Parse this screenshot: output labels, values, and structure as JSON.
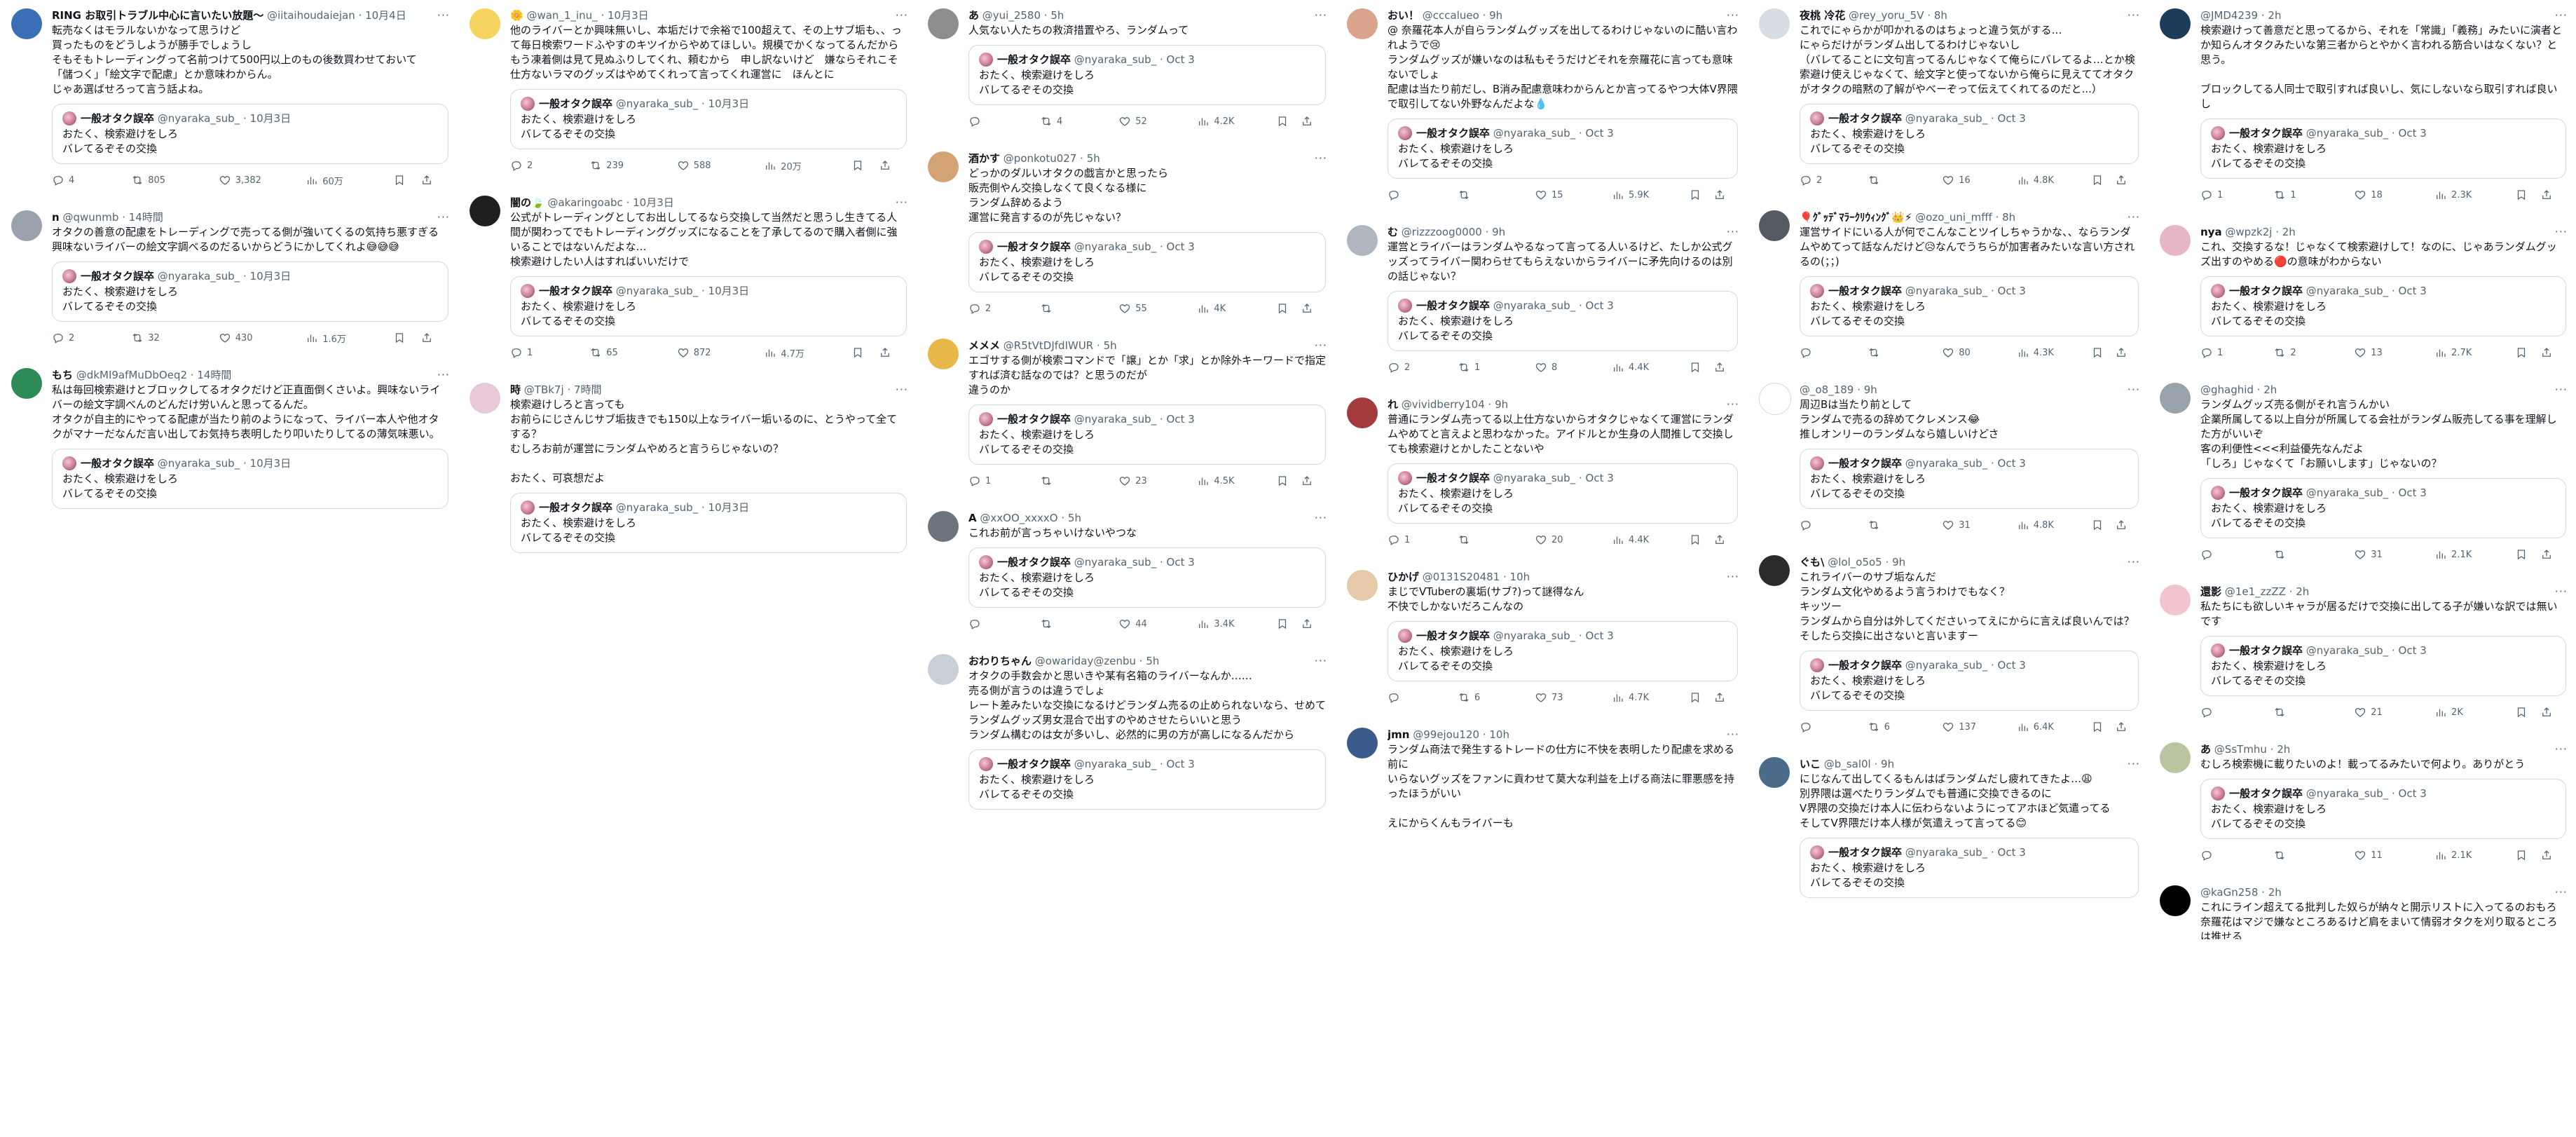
{
  "quote_default": {
    "name": "一般オタク誤卒",
    "handle": "@nyaraka_sub_",
    "text": "おたく、検索避けをしろ\nバレてるぞその交換"
  },
  "columns": [
    {
      "posts": [
        {
          "name": "RING お取引トラブル中心に言いたい放題〜",
          "handle": "@iitaihoudaiejan",
          "time": "10月4日",
          "avatar_color": "#3b6fb5",
          "text": "転売なくはモラルないかなって思うけど\n買ったものをどうしようが勝手でしょうし\nそもそもトレーディングって名前つけて500円以上のもの後数買わせておいて\n「儲つく」「絵文字で配慮」とか意味わからん。\nじゃあ選ばせろって言う話よね。",
          "quote_time": "10月3日",
          "reply": "4",
          "rt": "805",
          "like": "3,382",
          "view": "60万"
        },
        {
          "name": "n",
          "handle": "@qwunmb",
          "time": "14時間",
          "avatar_color": "#9aa3ad",
          "text": "オタクの善意の配慮をトレーディングで売ってる側が強いてくるの気持ち悪すぎる\n興味ないライバーの絵文字調べるのだるいからどうにかしてくれよ😅😅😅",
          "quote_time": "10月3日",
          "reply": "2",
          "rt": "32",
          "like": "430",
          "view": "1.6万"
        },
        {
          "name": "もち",
          "handle": "@dkMI9afMuDbOeq2",
          "time": "14時間",
          "avatar_color": "#2e8b57",
          "text": "私は毎回検索避けとブロックしてるオタクだけど正直面倒くさいよ。興味ないライバーの絵文字調べんのどんだけ労いんと思ってるんだ。\nオタクが自主的にやってる配慮が当たり前のようになって、ライバー本人や他オタクがマナーだなんだ言い出してお気持ち表明したり叩いたりしてるの薄気味悪い。",
          "quote_time": "10月3日",
          "reply": "",
          "rt": "",
          "like": "",
          "view": ""
        }
      ]
    },
    {
      "posts": [
        {
          "name": "🌼",
          "handle": "@wan_1_inu_",
          "time": "10月3日",
          "avatar_color": "#f4d35e",
          "text": "他のライバーとか興味無いし、本垢だけで余裕で100超えて、その上サブ垢も、、って毎日検索ワードふやすのキツイからやめてほしい。規模でかくなってるんだからもう凍着側は見て見ぬふりしてくれ、頼むから　申し訳ないけど　嫌ならそれこそ仕方ないラマのグッズはやめてくれって言ってくれ運営に　ほんとに",
          "quote_time": "10月3日",
          "reply": "2",
          "rt": "239",
          "like": "588",
          "view": "20万"
        },
        {
          "name": "闇の🍃",
          "handle": "@akaringoabc",
          "time": "10月3日",
          "avatar_color": "#1f1f1f",
          "text": "公式がトレーディングとしてお出ししてるなら交換して当然だと思うし生きてる人間が関わってでもトレーディンググッズになることを了承してるので購入者側に強いることではないんだよな…\n検索避けしたい人はすればいいだけで",
          "quote_time": "10月3日",
          "reply": "1",
          "rt": "65",
          "like": "872",
          "view": "4.7万"
        },
        {
          "name": "時",
          "handle": "@TBk7j",
          "time": "7時間",
          "avatar_color": "#e9c8d8",
          "text": "検索避けしろと言っても\nお前らにじさんじサブ垢抜きでも150以上なライバー垢いるのに、とうやって全てする？\nむしろお前が運営にランダムやめろと言うらじゃないの？\n\nおたく、可哀想だよ",
          "quote_time": "10月3日",
          "reply": "",
          "rt": "",
          "like": "",
          "view": ""
        }
      ]
    },
    {
      "posts": [
        {
          "name": "あ",
          "handle": "@yui_2580",
          "time": "5h",
          "avatar_color": "#8e8e8e",
          "text": "人気ない人たちの救済措置やろ、ランダムって",
          "quote_time": "Oct 3",
          "reply": "",
          "rt": "4",
          "like": "52",
          "view": "4.2K"
        },
        {
          "name": "酒かす",
          "handle": "@ponkotu027",
          "time": "5h",
          "avatar_color": "#d4a373",
          "text": "どっかのダルいオタクの戯言かと思ったら\n販売側やん交換しなくて良くなる様に\nランダム辞めるよう\n運営に発言するのが先じゃない？",
          "quote_time": "Oct 3",
          "reply": "2",
          "rt": "",
          "like": "55",
          "view": "4K"
        },
        {
          "name": "メメメ",
          "handle": "@R5tVtDJfdIWUR",
          "time": "5h",
          "avatar_color": "#e8b84a",
          "text": "エゴサする側が検索コマンドで「譲」とか「求」とか除外キーワードで指定すれば済む話なのでは？と思うのだが\n違うのか",
          "quote_time": "Oct 3",
          "reply": "1",
          "rt": "",
          "like": "23",
          "view": "4.5K"
        },
        {
          "name": "A",
          "handle": "@xxOO_xxxxO",
          "time": "5h",
          "avatar_color": "#6c757d",
          "text": "これお前が言っちゃいけないやつな",
          "quote_time": "Oct 3",
          "reply": "",
          "rt": "",
          "like": "44",
          "view": "3.4K"
        },
        {
          "name": "おわりちゃん",
          "handle": "@owariday@zenbu",
          "time": "5h",
          "avatar_color": "#c9cfd6",
          "text": "オタクの手数会かと思いきや某有名箱のライバーなんか……\n売る側が言うのは違うでしょ\nレート差みたいな交換になるけどランダム売るの止められないなら、せめてランダムグッズ男女混合で出すのやめさせたらいいと思う\nランダム構むのは女が多いし、必然的に男の方が高しになるんだから",
          "quote_time": "Oct 3",
          "reply": "",
          "rt": "",
          "like": "",
          "view": ""
        }
      ]
    },
    {
      "posts": [
        {
          "name": "おい！",
          "handle": "@cccalueo",
          "time": "9h",
          "avatar_color": "#d9a38c",
          "text": "@ 奈羅花本人が自らランダムグッズを出してるわけじゃないのに酷い言われようで😢\nランダムグッズが嫌いなのは私もそうだけどそれを奈羅花に言っても意味ないでしょ\n配慮は当たり前だし、B消み配慮意味わからんとか言ってるやつ大体V界隈で取引してない外野なんだよな💧",
          "quote_time": "Oct 3",
          "reply": "",
          "rt": "",
          "like": "15",
          "view": "5.9K"
        },
        {
          "name": "む",
          "handle": "@rizzzoog0000",
          "time": "9h",
          "avatar_color": "#b0b7bf",
          "text": "運営とライバーはランダムやるなって言ってる人いるけど、たしか公式グッズってライバー関わらせてもらえないからライバーに矛先向けるのは別の話じゃない？",
          "quote_time": "Oct 3",
          "reply": "2",
          "rt": "1",
          "like": "8",
          "view": "4.4K"
        },
        {
          "name": "れ",
          "handle": "@vividberry104",
          "time": "9h",
          "avatar_color": "#a23b3b",
          "text": "普通にランダム売ってる以上仕方ないからオタクじゃなくて運営にランダムやめてと言えよと思わなかった。アイドルとか生身の人間推して交換しても検索避けとかしたことないや",
          "quote_time": "Oct 3",
          "reply": "1",
          "rt": "",
          "like": "20",
          "view": "4.4K"
        },
        {
          "name": "ひかげ",
          "handle": "@0131S20481",
          "time": "10h",
          "avatar_color": "#e6c9a8",
          "text": "まじでVTuberの裏垢(サブ?)って謎得なん\n不快でしかないだろこんなの",
          "quote_time": "Oct 3",
          "reply": "",
          "rt": "6",
          "like": "73",
          "view": "4.7K"
        },
        {
          "name": "jmn",
          "handle": "@99ejou120",
          "time": "10h",
          "avatar_color": "#3a5a8c",
          "text": "ランダム商法で発生するトレードの仕方に不快を表明したり配慮を求める前に\nいらないグッズをファンに貢わせて莫大な利益を上げる商法に罪悪感を持ったほうがいい\n\nえにからくんもライバーも",
          "quote_time": "",
          "reply": "",
          "rt": "",
          "like": "",
          "view": ""
        }
      ]
    },
    {
      "posts": [
        {
          "name": "夜桃 冷花",
          "handle": "@rey_yoru_5V",
          "time": "8h",
          "avatar_color": "#d8dde3",
          "text": "これでにゃらかが叩かれるのはちょっと違う気がする…\nにゃらだけがランダム出してるわけじゃないし\n（バレてることに文句言ってるんじゃなくて俺らにバレてるよ…とか検索避け使えじゃなくて、絵文字と使ってないから俺らに見えててオタクがオタクの暗黙の了解がやべーぞって伝えてくれてるのだと...）",
          "quote_time": "Oct 3",
          "reply": "2",
          "rt": "",
          "like": "16",
          "view": "4.8K"
        },
        {
          "name": "🎈ｸﾞｯﾃﾞﾏﾗｰｸﾘｳｨﾝｸﾞ👑⚡",
          "handle": "@ozo_uni_mfff",
          "time": "8h",
          "avatar_color": "#555b63",
          "text": "運営サイドにいる人が何でこんなことツイしちゃうかな、、ならランダムやめてって話なんだけど😥なんでうちらが加害者みたいな言い方されるの(；；)",
          "quote_time": "Oct 3",
          "reply": "",
          "rt": "",
          "like": "80",
          "view": "4.3K"
        },
        {
          "name": "",
          "handle": "@_o8_189",
          "time": "9h",
          "avatar_color": "#ffffff",
          "text": "周辺Bは当たり前として\nランダムで売るの辞めてクレメンス😂\n推しオンリーのランダムなら嬉しいけどさ",
          "quote_time": "Oct 3",
          "reply": "",
          "rt": "",
          "like": "31",
          "view": "4.8K"
        },
        {
          "name": "ぐも\\",
          "handle": "@lol_o5o5",
          "time": "9h",
          "avatar_color": "#2b2b2b",
          "text": "これライバーのサブ垢なんだ\nランダム文化やめるよう言うわけでもなく？\nキッツー\nランダムから自分は外してくださいってえにからに言えば良いんでは？\nそしたら交換に出さないと言いますー",
          "quote_time": "Oct 3",
          "reply": "",
          "rt": "6",
          "like": "137",
          "view": "6.4K"
        },
        {
          "name": "いこ",
          "handle": "@b_sal0l",
          "time": "9h",
          "avatar_color": "#4a6b8a",
          "text": "にじなんて出してくるもんはばランダムだし疲れてきたよ…😩\n別界隈は選べたりランダムでも普通に交換できるのに\nV界隈の交換だけ本人に伝わらないようにってアホほど気遣ってる\nそしてV界隈だけ本人様が気遣えって言ってる😊",
          "quote_time": "Oct 3",
          "reply": "",
          "rt": "",
          "like": "",
          "view": ""
        }
      ]
    },
    {
      "posts": [
        {
          "name": "",
          "handle": "@JMD4239",
          "time": "2h",
          "avatar_color": "#1d3b5a",
          "text": "検索避けって善意だと思ってるから、それを「常識」「義務」みたいに演者とか知らんオタクみたいな第三者からとやかく言われる筋合いはなくない？と思う。\n\nブロックしてる人同士で取引すれば良いし、気にしないなら取引すれば良いし",
          "quote_time": "Oct 3",
          "reply": "1",
          "rt": "1",
          "like": "18",
          "view": "2.3K"
        },
        {
          "name": "nya",
          "handle": "@wpzk2j",
          "time": "2h",
          "avatar_color": "#e7b7c8",
          "text": "これ、交換するな！じゃなくて検索避けして！なのに、じゃあランダムグッズ出すのやめる🔴の意味がわからない",
          "quote_time": "Oct 3",
          "reply": "1",
          "rt": "2",
          "like": "13",
          "view": "2.7K"
        },
        {
          "name": "",
          "handle": "@ghaghid",
          "time": "2h",
          "avatar_color": "#9aa3ad",
          "text": "ランダムグッズ売る側がそれ言うんかい\n企業所属してる以上自分が所属してる会社がランダム販売してる事を理解した方がいいぞ\n客の利便性<<<利益優先なんだよ\n「しろ」じゃなくて「お願いします」じゃないの？",
          "quote_time": "Oct 3",
          "reply": "",
          "rt": "",
          "like": "31",
          "view": "2.1K"
        },
        {
          "name": "還影",
          "handle": "@1e1_zzZZ",
          "time": "2h",
          "avatar_color": "#f2c4d0",
          "text": "私たちにも欲しいキャラが居るだけで交換に出してる子が嫌いな訳では無いです",
          "quote_time": "Oct 3",
          "reply": "",
          "rt": "",
          "like": "21",
          "view": "2K"
        },
        {
          "name": "あ",
          "handle": "@SsTmhu",
          "time": "2h",
          "avatar_color": "#b8c5a0",
          "text": "むしろ検索機に載りたいのよ！載ってるみたいで何より。ありがとう",
          "quote_time": "Oct 3",
          "reply": "",
          "rt": "",
          "like": "11",
          "view": "2.1K"
        },
        {
          "name": "",
          "handle": "@kaGn258",
          "time": "2h",
          "avatar_color": "#000000",
          "text": "これにライン超えてる批判した奴らが納々と開示リストに入ってるのおもろ\n奈羅花はマジで嫌なところあるけど肩をまいて情弱オタクを刈り取るところは推せる",
          "quote_time": "",
          "reply": "",
          "rt": "",
          "like": "",
          "view": ""
        }
      ]
    }
  ]
}
